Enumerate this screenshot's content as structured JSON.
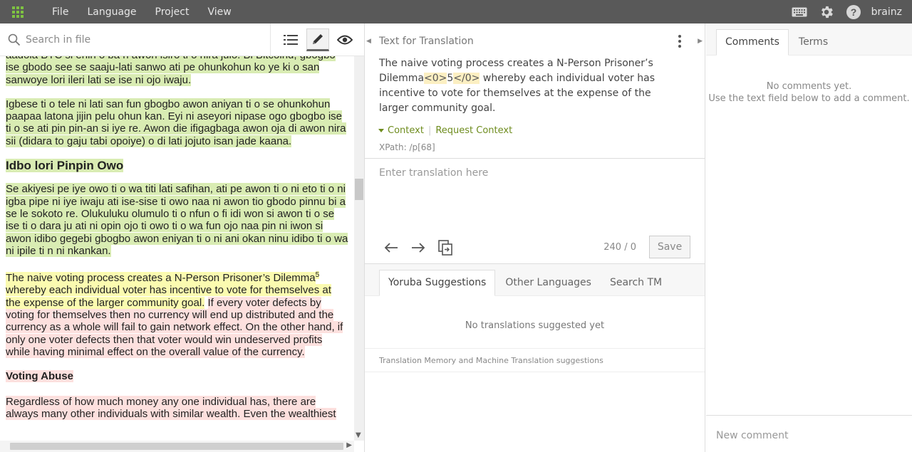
{
  "menu": [
    "File",
    "Language",
    "Project",
    "View"
  ],
  "user": {
    "name": "brainz"
  },
  "search": {
    "placeholder": "Search in file"
  },
  "document": {
    "para0": "aadoła BTC si enin o ba ń awon isiro ti o nira julo. Bi Bitcoind, gbogbo ise gbodo see se saaju-lati sanwo ati pe ohunkohun ko ye ki o san sanwoye lori ileri lati se ise ni ojo iwaju.",
    "para1": "Igbese ti o tele ni lati san fun gbogbo awon aniyan ti o se ohunkohun paapaa latona jijin pelu ohun kan. Eyi ni aseyori nipase ogo gbogbo ise ti o se ati pin pin-an si iye re. Awon die ifigagbaga awon oja di awon nira sii (didara to gaju tabi opoiye) o di lati jojuto isan jade kaana.",
    "heading1": "Idbo lori Pinpin Owo",
    "para2": "Se akiyesi pe iye owo ti o wa titi lati safihan, ati pe awon ti o ni eto ti o ni igba pipe ni iye iwaju ati ise-sise ti owo naa ni awon tio gbodo pinnu bi a se le sokoto re. Olukuluku olumulo ti o nfun o fi idi won si awon ti o se ise ti o dara ju ati ni opin ojo ti owo ti o wa fun ojo naa pin ni iwon si awon idibo gegebi gbogbo awon eniyan ti o ni ani okan ninu idibo ti o wa ni ipile ti n ni nkankan.",
    "para3_y": "The naive voting process creates a N-Person Prisoner’s Dilemma",
    "para3_sup": "5",
    "para3_y2": "whereby each individual voter has incentive to vote for themselves at the expense of the larger community goal.",
    "para3_r": "If every voter defects by voting for themselves then no currency will end up distributed and the currency as a whole will fail to gain network effect. On the other hand, if only one voter defects then that voter would win undeserved profits while having minimal effect on the overall value of the currency.",
    "heading2": "Voting Abuse",
    "para4": "Regardless of how much money any one individual has, there are always many other individuals with similar wealth. Even the wealthiest"
  },
  "translation_panel": {
    "title": "Text for Translation",
    "source_pre": "The naive voting process creates a N-Person Prisoner’s Dilemma",
    "source_tag_open": "<0>",
    "source_tag_content": "5",
    "source_tag_close": "</0>",
    "source_post": "whereby each individual voter has incentive to vote for themselves at the expense of the larger community goal.",
    "context_label": "Context",
    "request_context": "Request Context",
    "xpath": "XPath: /p[68]",
    "input_placeholder": "Enter translation here",
    "counter": "240 / 0",
    "save_label": "Save"
  },
  "suggestions": {
    "tabs": [
      "Yoruba Suggestions",
      "Other Languages",
      "Search TM"
    ],
    "empty": "No translations suggested yet",
    "footer": "Translation Memory and Machine Translation suggestions"
  },
  "comments": {
    "tabs": [
      "Comments",
      "Terms"
    ],
    "empty_line1": "No comments yet.",
    "empty_line2": "Use the text field below to add a comment.",
    "new_placeholder": "New comment"
  },
  "colors": {
    "topbar": "#595959",
    "accent_green": "#7ec242",
    "context_green": "#6e8c1e",
    "highlight_translated": "#d9ecb3",
    "highlight_current": "#fbfbb0",
    "highlight_untranslated": "#fde0de"
  }
}
